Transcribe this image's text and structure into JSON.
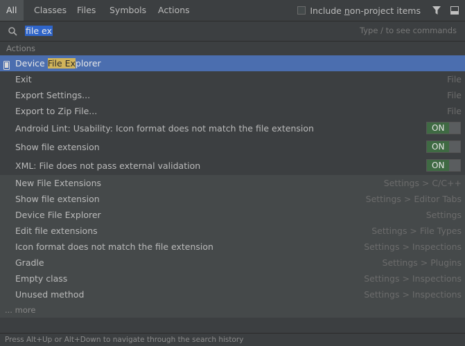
{
  "tabs": [
    "All",
    "Classes",
    "Files",
    "Symbols",
    "Actions"
  ],
  "include": {
    "pre": "Include ",
    "u": "n",
    "post": "on-project items"
  },
  "search": {
    "value": "file ex",
    "hint": "Type / to see commands"
  },
  "group_label": "Actions",
  "selected": {
    "pre": "Device ",
    "hl": "File Ex",
    "post": "plorer"
  },
  "actions": [
    {
      "label": "Exit",
      "loc": "File"
    },
    {
      "label": "Export Settings...",
      "loc": "File"
    },
    {
      "label": "Export to Zip File...",
      "loc": "File"
    }
  ],
  "toggles": [
    {
      "label": "Android Lint: Usability: Icon format does not match the file extension",
      "state": "ON"
    },
    {
      "label": "Show file extension",
      "state": "ON"
    },
    {
      "label": "XML: File does not pass external validation",
      "state": "ON"
    }
  ],
  "settings": [
    {
      "label": "New File Extensions",
      "loc": "Settings > C/C++"
    },
    {
      "label": "Show file extension",
      "loc": "Settings > Editor Tabs"
    },
    {
      "label": "Device File Explorer",
      "loc": "Settings"
    },
    {
      "label": "Edit file extensions",
      "loc": "Settings > File Types"
    },
    {
      "label": "Icon format does not match the file extension",
      "loc": "Settings > Inspections"
    },
    {
      "label": "Gradle",
      "loc": "Settings > Plugins"
    },
    {
      "label": "Empty class",
      "loc": "Settings > Inspections"
    },
    {
      "label": "Unused method",
      "loc": "Settings > Inspections"
    }
  ],
  "more": "... more",
  "footer": "Press Alt+Up or Alt+Down to navigate through the search history",
  "colors": {
    "selection": "#4b6eaf",
    "highlight": "#d1b45a",
    "toggle_on": "#3f6a43"
  }
}
